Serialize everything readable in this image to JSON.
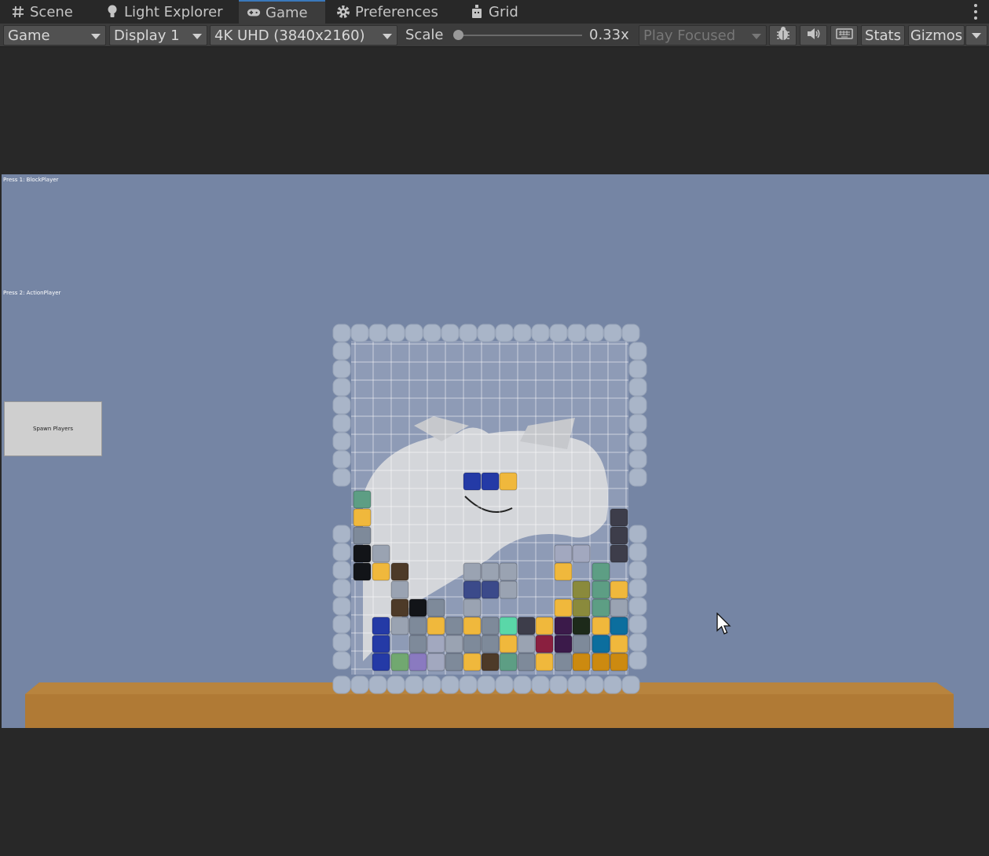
{
  "tabs": [
    {
      "label": "Scene",
      "icon": "hash-icon"
    },
    {
      "label": "Light Explorer",
      "icon": "lightbulb-icon"
    },
    {
      "label": "Game",
      "icon": "gamepad-icon",
      "active": true
    },
    {
      "label": "Preferences",
      "icon": "gear-icon"
    },
    {
      "label": "Grid",
      "icon": "grid-icon"
    }
  ],
  "toolbar": {
    "view_mode": "Game",
    "display": "Display 1",
    "resolution": "4K UHD (3840x2160)",
    "scale_label": "Scale",
    "scale_value": "0.33x",
    "scale_fraction": 0.0,
    "play_mode": "Play Focused",
    "stats_label": "Stats",
    "gizmos_label": "Gizmos"
  },
  "game": {
    "hud_line1": "Press 1: BlockPlayer",
    "hud_line2": "Press 2: ActionPlayer",
    "spawn_button": "Spawn Players",
    "background_color": "#7585a4",
    "table_color": "#b07a35",
    "frame_color": "#a9b5c8"
  }
}
